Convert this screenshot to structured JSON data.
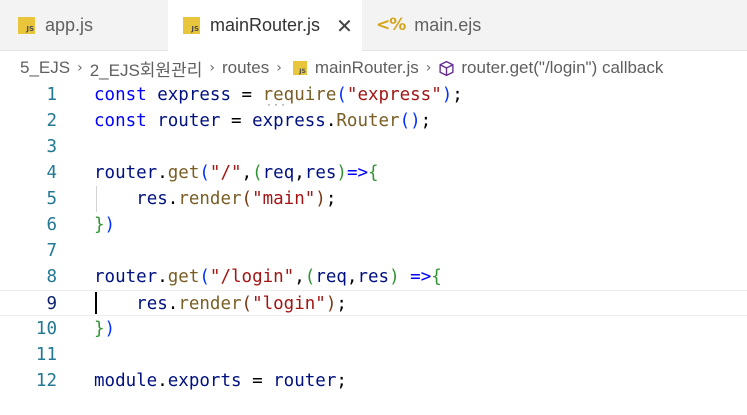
{
  "tabs": [
    {
      "label": "app.js",
      "icon": "js-file-icon",
      "badge": "JS"
    },
    {
      "label": "mainRouter.js",
      "icon": "js-file-icon",
      "badge": "JS",
      "close": "✕"
    },
    {
      "label": "main.ejs",
      "icon": "ejs-file-icon",
      "badge": "<%"
    }
  ],
  "breadcrumb": {
    "items": [
      "5_EJS",
      "2_EJS회원관리",
      "routes",
      "mainRouter.js",
      "router.get(\"/login\") callback"
    ],
    "separator": "›"
  },
  "editor": {
    "current_line": 9,
    "lines": [
      {
        "n": "1",
        "tokens": [
          [
            "kw",
            "const"
          ],
          [
            "p",
            " "
          ],
          [
            "var",
            "express"
          ],
          [
            "p",
            " = "
          ],
          [
            "fn",
            "require"
          ],
          [
            "b1",
            "("
          ],
          [
            "str",
            "\"express\""
          ],
          [
            "b1",
            ")"
          ],
          [
            "p",
            ";"
          ]
        ]
      },
      {
        "n": "2",
        "tokens": [
          [
            "kw",
            "const"
          ],
          [
            "p",
            " "
          ],
          [
            "var",
            "router"
          ],
          [
            "p",
            " = "
          ],
          [
            "var",
            "express"
          ],
          [
            "p",
            "."
          ],
          [
            "fn",
            "Router"
          ],
          [
            "b1",
            "()"
          ],
          [
            "p",
            ";"
          ]
        ]
      },
      {
        "n": "3",
        "tokens": []
      },
      {
        "n": "4",
        "tokens": [
          [
            "var",
            "router"
          ],
          [
            "p",
            "."
          ],
          [
            "fn",
            "get"
          ],
          [
            "b1",
            "("
          ],
          [
            "str",
            "\"/\""
          ],
          [
            "p",
            ","
          ],
          [
            "b2",
            "("
          ],
          [
            "var",
            "req"
          ],
          [
            "p",
            ","
          ],
          [
            "var",
            "res"
          ],
          [
            "b2",
            ")"
          ],
          [
            "kw",
            "=>"
          ],
          [
            "b2",
            "{"
          ]
        ]
      },
      {
        "n": "5",
        "tokens": [
          [
            "p",
            "    "
          ],
          [
            "var",
            "res"
          ],
          [
            "p",
            "."
          ],
          [
            "fn",
            "render"
          ],
          [
            "b3",
            "("
          ],
          [
            "str",
            "\"main\""
          ],
          [
            "b3",
            ")"
          ],
          [
            "p",
            ";"
          ]
        ]
      },
      {
        "n": "6",
        "tokens": [
          [
            "b2",
            "}"
          ],
          [
            "b1",
            ")"
          ]
        ]
      },
      {
        "n": "7",
        "tokens": []
      },
      {
        "n": "8",
        "tokens": [
          [
            "var",
            "router"
          ],
          [
            "p",
            "."
          ],
          [
            "fn",
            "get"
          ],
          [
            "b1",
            "("
          ],
          [
            "str",
            "\"/login\""
          ],
          [
            "p",
            ","
          ],
          [
            "b2",
            "("
          ],
          [
            "var",
            "req"
          ],
          [
            "p",
            ","
          ],
          [
            "var",
            "res"
          ],
          [
            "b2",
            ")"
          ],
          [
            "p",
            " "
          ],
          [
            "kw",
            "=>"
          ],
          [
            "b2",
            "{"
          ]
        ]
      },
      {
        "n": "9",
        "tokens": [
          [
            "p",
            "    "
          ],
          [
            "var",
            "res"
          ],
          [
            "p",
            "."
          ],
          [
            "fn",
            "render"
          ],
          [
            "b3",
            "("
          ],
          [
            "str",
            "\"login\""
          ],
          [
            "b3",
            ")"
          ],
          [
            "p",
            ";"
          ]
        ]
      },
      {
        "n": "10",
        "tokens": [
          [
            "b2",
            "}"
          ],
          [
            "b1",
            ")"
          ]
        ]
      },
      {
        "n": "11",
        "tokens": []
      },
      {
        "n": "12",
        "tokens": [
          [
            "var",
            "module"
          ],
          [
            "p",
            "."
          ],
          [
            "var",
            "exports"
          ],
          [
            "p",
            " = "
          ],
          [
            "var",
            "router"
          ],
          [
            "p",
            ";"
          ]
        ]
      }
    ]
  },
  "colors": {
    "keyword": "#0000ff",
    "string": "#a31515",
    "function": "#795e26",
    "variable": "#001080",
    "line_number": "#237893",
    "js_badge": "#e8c53a"
  }
}
